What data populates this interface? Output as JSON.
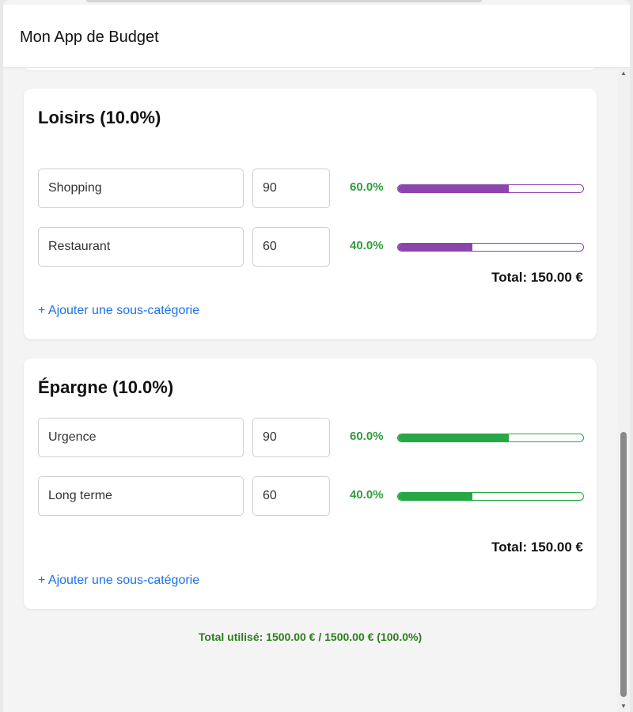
{
  "app": {
    "title": "Mon App de Budget"
  },
  "categories": [
    {
      "title": "Loisirs (10.0%)",
      "color": "#8e44ad",
      "subcategories": [
        {
          "name": "Shopping",
          "amount": "90",
          "percent_label": "60.0%",
          "percent": 0.6
        },
        {
          "name": "Restaurant",
          "amount": "60",
          "percent_label": "40.0%",
          "percent": 0.4
        }
      ],
      "total": "Total: 150.00 €",
      "add_label": "+ Ajouter une sous-catégorie"
    },
    {
      "title": "Épargne (10.0%)",
      "color": "#28a745",
      "subcategories": [
        {
          "name": "Urgence",
          "amount": "90",
          "percent_label": "60.0%",
          "percent": 0.6
        },
        {
          "name": "Long terme",
          "amount": "60",
          "percent_label": "40.0%",
          "percent": 0.4
        }
      ],
      "total": "Total: 150.00 €",
      "add_label": "+ Ajouter une sous-catégorie"
    }
  ],
  "summary": {
    "text": "Total utilisé: 1500.00 € / 1500.00 € (100.0%)",
    "color": "#2e7d1e"
  },
  "scrollbar": {
    "up_icon": "scroll-up-arrow-icon",
    "down_icon": "scroll-down-arrow-icon"
  }
}
